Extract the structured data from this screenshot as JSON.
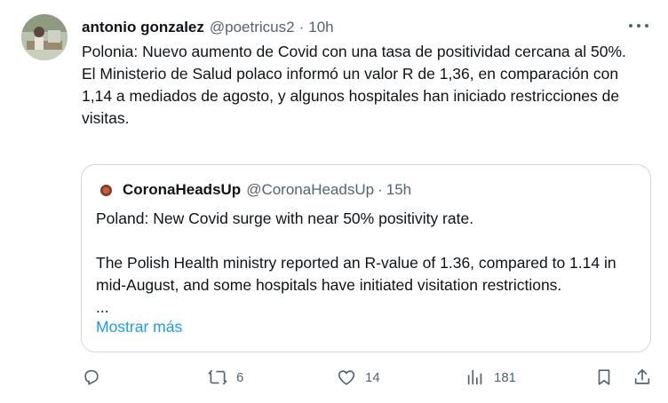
{
  "tweet": {
    "author": {
      "display_name": "antonio gonzalez",
      "handle": "@poetricus2",
      "time": "10h"
    },
    "separator": "·",
    "text_paragraphs": [
      "Polonia: Nuevo aumento de Covid con una tasa de positividad cercana al 50%.",
      "El Ministerio de Salud polaco informó un valor R de 1,36, en comparación con 1,14 a mediados de agosto, y algunos hospitales han iniciado restricciones de visitas."
    ],
    "quote": {
      "display_name": "CoronaHeadsUp",
      "handle": "@CoronaHeadsUp",
      "time": "15h",
      "line1": "Poland: New Covid surge with near 50% positivity rate.",
      "line2": "The Polish Health ministry reported an R-value of 1.36, compared to 1.14 in mid-August, and some hospitals have initiated visitation restrictions.",
      "ellipsis": "...",
      "show_more": "Mostrar más"
    },
    "actions": {
      "reply_count": "",
      "retweet_count": "6",
      "like_count": "14",
      "views_count": "181"
    },
    "icons": {
      "reply": "reply-icon",
      "retweet": "retweet-icon",
      "like": "heart-icon",
      "views": "views-icon",
      "bookmark": "bookmark-icon",
      "share": "share-icon",
      "more": "more-icon"
    },
    "colors": {
      "text": "#0f1419",
      "secondary": "#536471",
      "link": "#1d9bf0",
      "border": "#cfd9de"
    }
  }
}
